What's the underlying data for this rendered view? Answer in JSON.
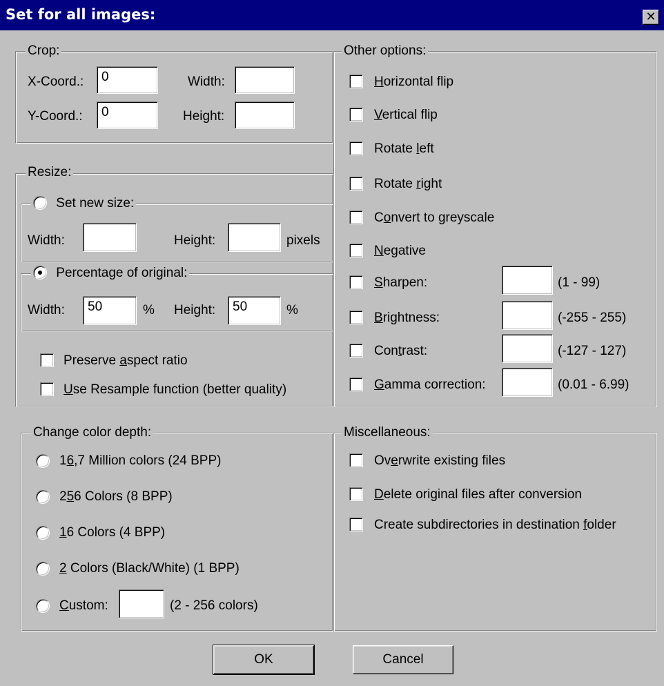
{
  "window": {
    "title": "Set for all images:",
    "close_glyph": "✕"
  },
  "crop": {
    "legend": "Crop:",
    "x_label": "X-Coord.:",
    "x_value": "0",
    "y_label": "Y-Coord.:",
    "y_value": "0",
    "width_label": "Width:",
    "width_value": "",
    "height_label": "Height:",
    "height_value": ""
  },
  "resize": {
    "legend": "Resize:",
    "set_new_size": {
      "label": "Set new size:",
      "selected": false,
      "width_label": "Width:",
      "width_value": "",
      "height_label": "Height:",
      "height_value": "",
      "unit": "pixels"
    },
    "percentage": {
      "label": "Percentage of original:",
      "selected": true,
      "width_label": "Width:",
      "width_value": "50",
      "width_unit": "%",
      "height_label": "Height:",
      "height_value": "50",
      "height_unit": "%"
    },
    "preserve_aspect": {
      "label_pre": "Preserve ",
      "accel": "a",
      "label_post": "spect ratio",
      "checked": false
    },
    "resample": {
      "label_pre": "",
      "accel": "U",
      "label_post": "se Resample function (better quality)",
      "checked": false
    }
  },
  "other_options": {
    "legend": "Other options:",
    "items": [
      {
        "pre": "",
        "accel": "H",
        "post": "orizontal flip",
        "checked": false
      },
      {
        "pre": "",
        "accel": "V",
        "post": "ertical flip",
        "checked": false
      },
      {
        "pre": "Rotate ",
        "accel": "l",
        "post": "eft",
        "checked": false
      },
      {
        "pre": "Rotate ",
        "accel": "r",
        "post": "ight",
        "checked": false
      },
      {
        "pre": "C",
        "accel": "o",
        "post": "nvert to greyscale",
        "checked": false
      },
      {
        "pre": "",
        "accel": "N",
        "post": "egative",
        "checked": false
      },
      {
        "pre": "",
        "accel": "S",
        "post": "harpen:",
        "checked": false,
        "value": "",
        "range": "(1 - 99)"
      },
      {
        "pre": "",
        "accel": "B",
        "post": "rightness:",
        "checked": false,
        "value": "",
        "range": "(-255 - 255)"
      },
      {
        "pre": "Con",
        "accel": "t",
        "post": "rast:",
        "checked": false,
        "value": "",
        "range": "(-127 - 127)"
      },
      {
        "pre": "",
        "accel": "G",
        "post": "amma correction:",
        "checked": false,
        "value": "",
        "range": "(0.01 - 6.99)"
      }
    ]
  },
  "color_depth": {
    "legend": "Change color depth:",
    "options": [
      {
        "pre": "1",
        "accel": "6",
        "post": ",7 Million colors (24 BPP)",
        "selected": false
      },
      {
        "pre": "2",
        "accel": "5",
        "post": "6 Colors (8 BPP)",
        "selected": false
      },
      {
        "pre": "",
        "accel": "1",
        "post": "6 Colors (4 BPP)",
        "selected": false
      },
      {
        "pre": "",
        "accel": "2",
        "post": " Colors (Black/White) (1 BPP)",
        "selected": false
      },
      {
        "pre": "",
        "accel": "C",
        "post": "ustom:",
        "selected": false,
        "value": "",
        "range": "(2 - 256 colors)"
      }
    ]
  },
  "misc": {
    "legend": "Miscellaneous:",
    "items": [
      {
        "pre": "Ov",
        "accel": "e",
        "post": "rwrite existing files",
        "checked": false
      },
      {
        "pre": "",
        "accel": "D",
        "post": "elete original files after conversion",
        "checked": false
      },
      {
        "pre": "Create subdirectories in destination ",
        "accel": "f",
        "post": "older",
        "checked": false
      }
    ]
  },
  "buttons": {
    "ok": "OK",
    "cancel": "Cancel"
  }
}
